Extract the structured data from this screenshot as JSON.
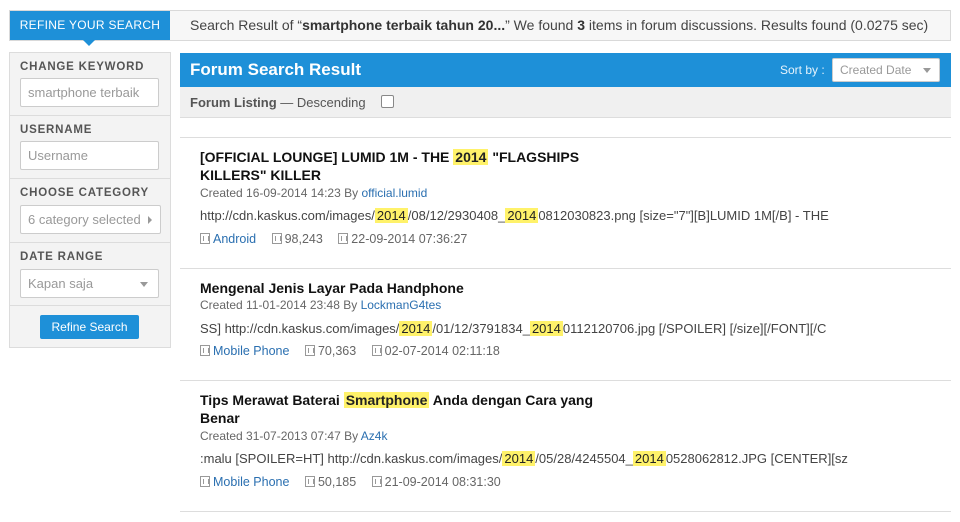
{
  "topbar": {
    "refine_tab": "REFINE YOUR SEARCH",
    "summary_prefix": "Search Result of “",
    "summary_query": "smartphone terbaik tahun 20...",
    "summary_mid": "” We found ",
    "summary_count": "3",
    "summary_suffix": " items in forum discussions. Results found (0.0275 sec)"
  },
  "sidebar": {
    "keyword_label": "CHANGE KEYWORD",
    "keyword_value": "smartphone terbaik",
    "username_label": "USERNAME",
    "username_placeholder": "Username",
    "category_label": "CHOOSE CATEGORY",
    "category_value": "6 category selected",
    "date_label": "DATE RANGE",
    "date_value": "Kapan saja",
    "refine_button": "Refine Search"
  },
  "main": {
    "title": "Forum Search Result",
    "sort_label": "Sort by :",
    "sort_value": "Created Date",
    "listing_label": "Forum Listing",
    "listing_order": " — Descending"
  },
  "posts": [
    {
      "title_parts": [
        "[OFFICIAL LOUNGE] LUMID 1M - THE ",
        "2014",
        " \"FLAGSHIPS KILLERS\" KILLER"
      ],
      "created": "Created 16-09-2014 14:23 By ",
      "author": "official.lumid",
      "snippet_parts": [
        "http://cdn.kaskus.com/images/",
        "2014",
        "/08/12/2930408_",
        "2014",
        "0812030823.png [size=\"7\"][B]LUMID 1M[/B] - THE"
      ],
      "category": "Android",
      "views": "98,243",
      "last_date": "22-09-2014 07:36:27"
    },
    {
      "title_parts": [
        "Mengenal Jenis Layar Pada Handphone"
      ],
      "created": "Created 11-01-2014 23:48 By ",
      "author": "LockmanG4tes",
      "snippet_parts": [
        "SS] http://cdn.kaskus.com/images/",
        "2014",
        "/01/12/3791834_",
        "2014",
        "0112120706.jpg [/SPOILER] [/size][/FONT][/C"
      ],
      "category": "Mobile Phone",
      "views": "70,363",
      "last_date": "02-07-2014 02:11:18"
    },
    {
      "title_parts": [
        "Tips Merawat Baterai ",
        "Smartphone",
        " Anda dengan Cara yang Benar"
      ],
      "created": "Created 31-07-2013 07:47 By ",
      "author": "Az4k",
      "snippet_parts": [
        ":malu [SPOILER=HT] http://cdn.kaskus.com/images/",
        "2014",
        "/05/28/4245504_",
        "2014",
        "0528062812.JPG [CENTER][sz"
      ],
      "category": "Mobile Phone",
      "views": "50,185",
      "last_date": "21-09-2014 08:31:30"
    }
  ]
}
